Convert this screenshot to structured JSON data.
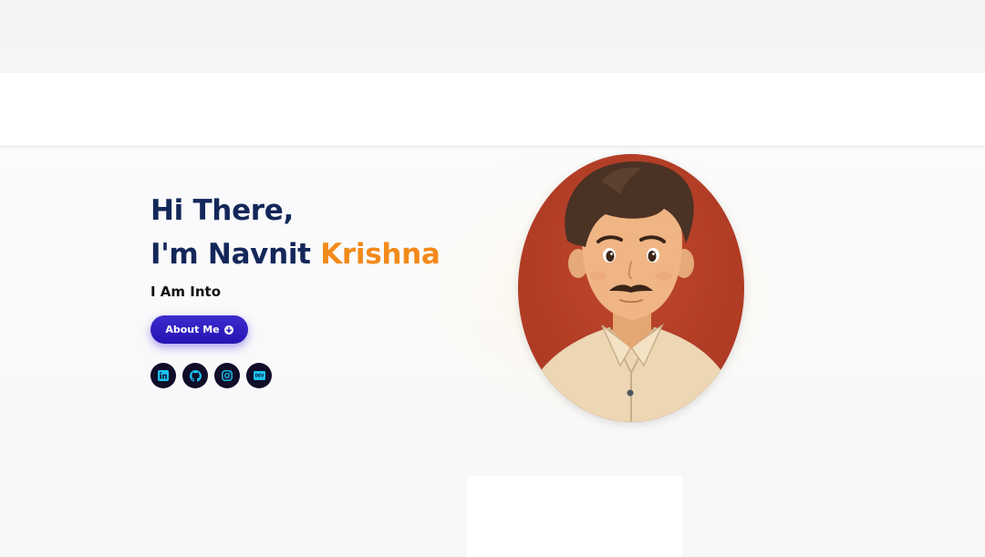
{
  "hero": {
    "greeting_line1": "Hi There,",
    "greeting_line2_prefix": "I'm Navnit ",
    "greeting_line2_accent": "Krishna",
    "subtitle": "I Am Into",
    "about_button_label": "About Me",
    "about_button_icon": "arrow-down-circle-icon",
    "socials": [
      {
        "name": "linkedin",
        "icon": "linkedin-icon"
      },
      {
        "name": "github",
        "icon": "github-icon"
      },
      {
        "name": "instagram",
        "icon": "instagram-icon"
      },
      {
        "name": "dev",
        "icon": "dev-icon",
        "label": "DEV"
      }
    ],
    "portrait": "avatar-illustration"
  },
  "colors": {
    "heading": "#14275a",
    "accent": "#f28a1b",
    "button": "#2614b4",
    "social_bg": "#0f0d28",
    "social_icon": "#19c2f0",
    "portrait_bg": "#b8402a"
  }
}
